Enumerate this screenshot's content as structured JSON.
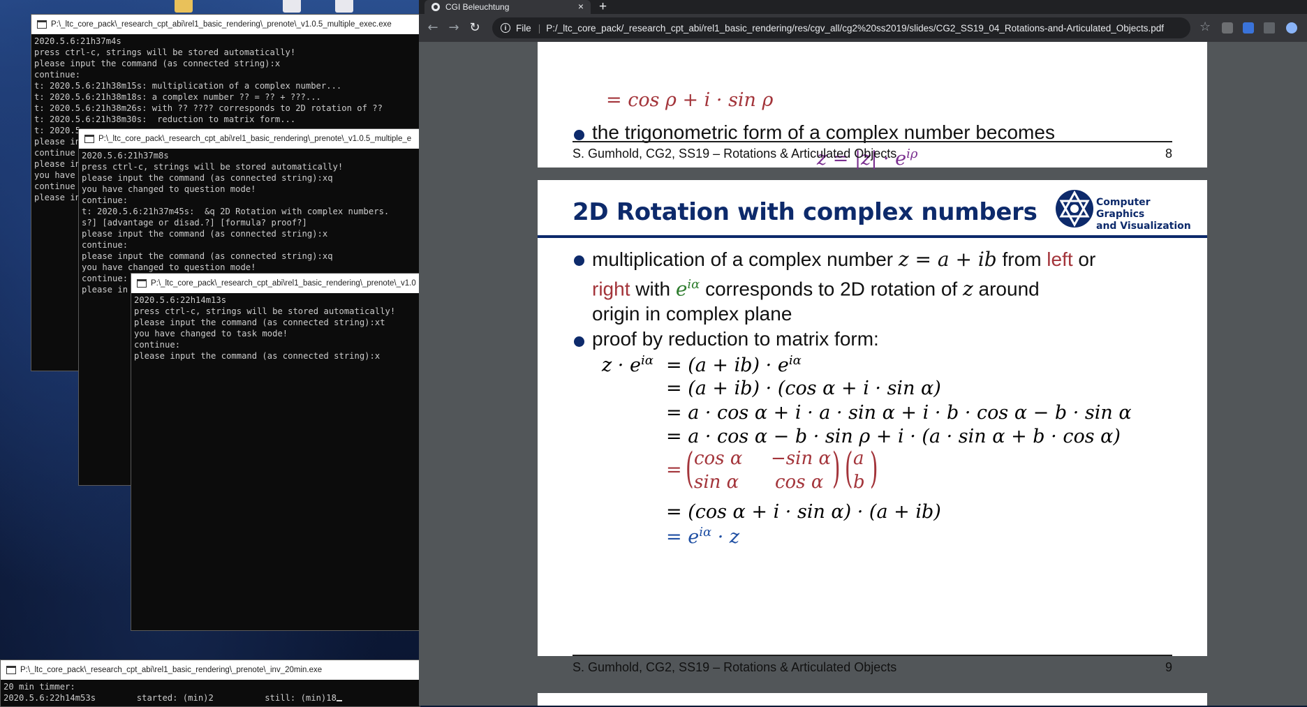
{
  "consoles": [
    {
      "title": "P:\\_ltc_core_pack\\_research_cpt_abi\\rel1_basic_rendering\\_prenote\\_v1.0.5_multiple_exec.exe",
      "lines": [
        "2020.5.6:21h37m4s",
        "press ctrl-c, strings will be stored automatically!",
        "please input the command (as connected string):x",
        "continue:",
        "t: 2020.5.6:21h38m15s: multiplication of a complex number...",
        "t: 2020.5.6:21h38m18s: a complex number ?? = ?? + ???...",
        "t: 2020.5.6:21h38m26s: with ?? ???? corresponds to 2D rotation of ??",
        "t: 2020.5.6:21h38m30s:  reduction to matrix form...",
        "t: 2020.5",
        "please in",
        "continue",
        "please in",
        "you have",
        "continue",
        "please in"
      ]
    },
    {
      "title": "P:\\_ltc_core_pack\\_research_cpt_abi\\rel1_basic_rendering\\_prenote\\_v1.0.5_multiple_e",
      "lines": [
        "2020.5.6:21h37m8s",
        "press ctrl-c, strings will be stored automatically!",
        "please input the command (as connected string):xq",
        "you have changed to question mode!",
        "continue:",
        "t: 2020.5.6:21h37m45s:  &q 2D Rotation with complex numbers.",
        "s?] [advantage or disad.?] [formula? proof?]",
        "please input the command (as connected string):x",
        "continue:",
        "please input the command (as connected string):xq",
        "you have changed to question mode!",
        "continue:",
        "please in"
      ]
    },
    {
      "title": "P:\\_ltc_core_pack\\_research_cpt_abi\\rel1_basic_rendering\\_prenote\\_v1.0",
      "lines": [
        "2020.5.6:22h14m13s",
        "press ctrl-c, strings will be stored automatically!",
        "please input the command (as connected string):xt",
        "you have changed to task mode!",
        "continue:",
        "please input the command (as connected string):x"
      ]
    },
    {
      "title": "P:\\_ltc_core_pack\\_research_cpt_abi\\rel1_basic_rendering\\_prenote\\_inv_20min.exe",
      "lines": [
        "20 min timmer:",
        "2020.5.6:22h14m53s        started: (min)2          still: (min)18"
      ]
    }
  ],
  "browser": {
    "tab_title": "CGI Beleuchtung",
    "tab_close": "×",
    "new_tab": "+",
    "scheme": "File",
    "url": "P:/_ltc_core_pack/_research_cpt_abi/rel1_basic_rendering/res/cgv_all/cg2%20ss2019/slides/CG2_SS19_04_Rotations-and-Articulated_Objects.pdf",
    "back": "←",
    "forward": "→",
    "reload": "↻",
    "star": "☆"
  },
  "slide8": {
    "eq_top": "= cos ρ + i · sin ρ",
    "bullet": "the trigonometric form of a complex number becomes",
    "eq_polar": "z = |z| · e",
    "eq_polar_sup": "iρ",
    "footer": "S. Gumhold, CG2, SS19 – Rotations & Articulated Objects",
    "page": "8"
  },
  "slide9": {
    "title": "2D Rotation with complex numbers",
    "logo_line1": "Computer Graphics",
    "logo_line2": "and Visualization",
    "b1_part1": "multiplication of a complex number ",
    "b1_math": "z = a + ib",
    "b1_part2": " from ",
    "b1_left": "left",
    "b1_or": " or",
    "b1_right": "right",
    "b1_with": " with ",
    "b1_exp": "e",
    "b1_exp_sup": "iα",
    "b1_part3": " corresponds to 2D rotation of ",
    "b1_z": "z",
    "b1_part4": " around",
    "b1_line3": "origin in complex plane",
    "b2": "proof by reduction to matrix form:",
    "eq0_lhs": "z · e",
    "eq0_lhs_sup": "iα",
    "eq0": "= (a + ib) · e",
    "eq0_sup": "iα",
    "eq1": "= (a + ib) · (cos α + i · sin α)",
    "eq2": "= a · cos α + i · a · sin α + i · b · cos α − b · sin α",
    "eq3": "= a · cos α − b · sin ρ + i · (a · sin α + b · cos α)",
    "eq4_eq": "=",
    "m11": "cos α",
    "m12": "−sin α",
    "m21": "sin α",
    "m22": "cos α",
    "v1": "a",
    "v2": "b",
    "eq5": "= (cos α + i · sin α) · (a + ib)",
    "eq6": "= e",
    "eq6_sup": "iα",
    "eq6_tail": " · z",
    "footer": "S. Gumhold, CG2, SS19 – Rotations & Articulated Objects",
    "page": "9"
  }
}
